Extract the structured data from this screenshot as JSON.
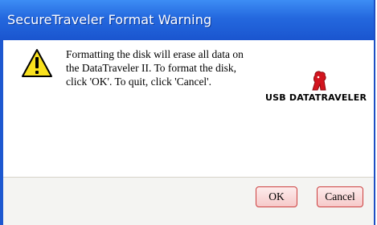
{
  "window": {
    "title": "SecureTraveler Format Warning"
  },
  "dialog": {
    "icon": "warning-icon",
    "message": "Formatting the disk will erase all data on the DataTraveler II.  To format the disk, click 'OK'.  To quit, click 'Cancel'."
  },
  "logo": {
    "text": "USB DATATRAVELER",
    "icon": "kingston-logo-icon"
  },
  "buttons": {
    "ok_label": "OK",
    "cancel_label": "Cancel"
  },
  "colors": {
    "titlebar": "#2468de",
    "button_border": "#cc3f3f",
    "button_fill": "#f6c9c9",
    "logo_red": "#d2141e"
  }
}
